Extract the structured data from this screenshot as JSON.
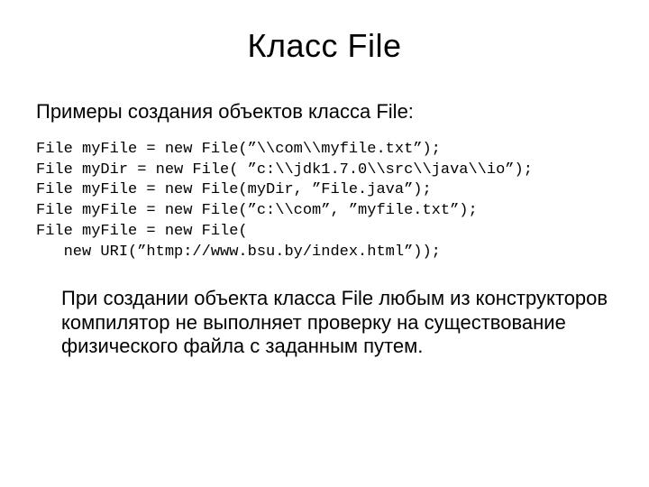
{
  "title": "Класс File",
  "subtitle": "Примеры создания объектов класса File:",
  "code": "File myFile = new File(”\\\\com\\\\myfile.txt”);\nFile myDir = new File( ”c:\\\\jdk1.7.0\\\\src\\\\java\\\\io”);\nFile myFile = new File(myDir, ”File.java”);\nFile myFile = new File(”c:\\\\com”, ”myfile.txt”);\nFile myFile = new File(\n   new URI(”htmp://www.bsu.by/index.html”));",
  "body": "При создании объекта класса File любым из конструкторов компилятор не выполняет проверку на существование физического файла с заданным путем."
}
